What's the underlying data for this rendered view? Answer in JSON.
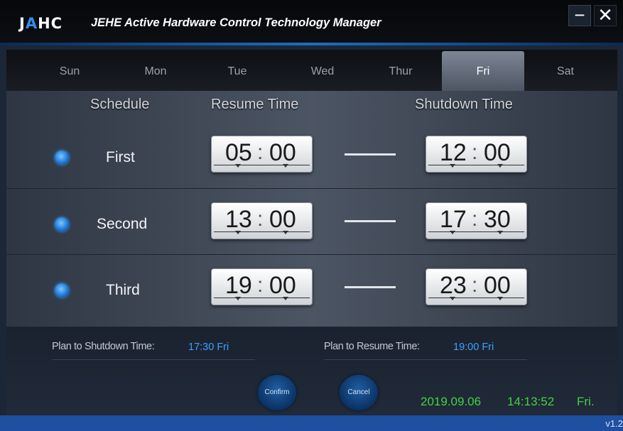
{
  "window": {
    "logo": {
      "part1": "J",
      "part2": "A",
      "part3": "HC"
    },
    "title": "JEHE Active Hardware Control Technology Manager",
    "minimize_glyph": "−",
    "close_glyph": "✕"
  },
  "tabs": [
    "Sun",
    "Mon",
    "Tue",
    "Wed",
    "Thur",
    "Fri",
    "Sat"
  ],
  "active_tab": "Fri",
  "headers": {
    "schedule": "Schedule",
    "resume": "Resume Time",
    "shutdown": "Shutdown Time"
  },
  "rows": [
    {
      "label": "First",
      "resume": {
        "h": "05",
        "m": "00"
      },
      "shutdown": {
        "h": "12",
        "m": "00"
      }
    },
    {
      "label": "Second",
      "resume": {
        "h": "13",
        "m": "00"
      },
      "shutdown": {
        "h": "17",
        "m": "30"
      }
    },
    {
      "label": "Third",
      "resume": {
        "h": "19",
        "m": "00"
      },
      "shutdown": {
        "h": "23",
        "m": "00"
      }
    }
  ],
  "time_separator": ":",
  "plan": {
    "shutdown_label": "Plan to Shutdown Time:",
    "shutdown_value": "17:30  Fri",
    "resume_label": "Plan to Resume Time:",
    "resume_value": "19:00  Fri"
  },
  "buttons": {
    "confirm": "Confirm",
    "cancel": "Cancel"
  },
  "status": {
    "date": "2019.09.06",
    "time": "14:13:52",
    "day": "Fri."
  },
  "version": "v1.2",
  "colors": {
    "accent": "#2f8ff0",
    "plan_value": "#3ea0ff",
    "clock_text": "#41d341"
  }
}
